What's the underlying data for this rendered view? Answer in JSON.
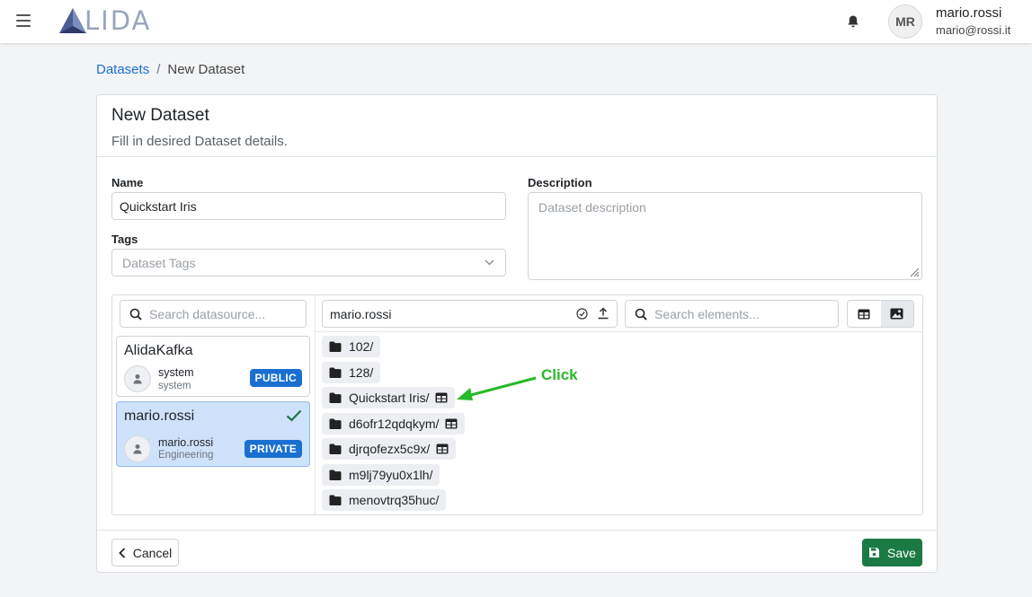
{
  "header": {
    "logo_text": "LIDA",
    "avatar_initials": "MR",
    "user_name": "mario.rossi",
    "user_email": "mario@rossi.it"
  },
  "breadcrumb": {
    "root": "Datasets",
    "separator": "/",
    "current": "New Dataset"
  },
  "card": {
    "title": "New Dataset",
    "subtitle": "Fill in desired Dataset details."
  },
  "form": {
    "name_label": "Name",
    "name_value": "Quickstart Iris",
    "tags_label": "Tags",
    "tags_placeholder": "Dataset Tags",
    "description_label": "Description",
    "description_placeholder": "Dataset description"
  },
  "browser": {
    "datasource_search_placeholder": "Search datasource...",
    "path_value": "mario.rossi",
    "elements_search_placeholder": "Search elements...",
    "datasources": [
      {
        "name": "AlidaKafka",
        "owner": "system",
        "org": "system",
        "badge": "PUBLIC",
        "selected": false
      },
      {
        "name": "mario.rossi",
        "owner": "mario.rossi",
        "org": "Engineering",
        "badge": "PRIVATE",
        "selected": true
      }
    ],
    "folders": [
      {
        "name": "102/",
        "tabular": false
      },
      {
        "name": "128/",
        "tabular": false
      },
      {
        "name": "Quickstart Iris/",
        "tabular": true
      },
      {
        "name": "d6ofr12qdqkym/",
        "tabular": true
      },
      {
        "name": "djrqofezx5c9x/",
        "tabular": true
      },
      {
        "name": "m9lj79yu0x1lh/",
        "tabular": false
      },
      {
        "name": "menovtrq35huc/",
        "tabular": false
      }
    ]
  },
  "annotation": {
    "text": "Click",
    "color": "#28b928"
  },
  "footer": {
    "cancel_label": "Cancel",
    "save_label": "Save"
  },
  "colors": {
    "primary": "#1a6fd1",
    "success": "#1b7a43",
    "selected_bg": "#cfe2fb"
  }
}
